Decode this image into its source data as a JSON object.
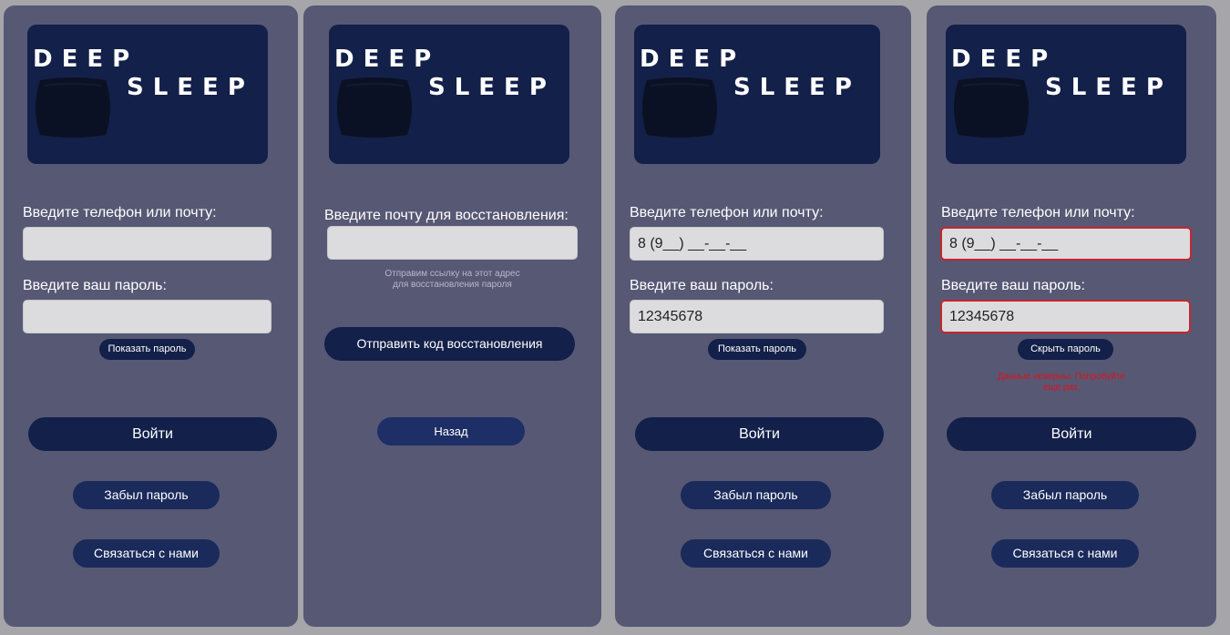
{
  "brand": {
    "word1": "DEEP",
    "word2": "SLEEP"
  },
  "colors": {
    "panel": "#575874",
    "logo_bg": "#132049",
    "button": "#132049",
    "field_bg": "#dcdcde",
    "error": "#e0101a",
    "background": "#a6a6aa"
  },
  "screen1": {
    "login_label": "Введите телефон или почту:",
    "login_value": "",
    "password_label": "Введите ваш пароль:",
    "password_value": "",
    "toggle_label": "Показать пароль",
    "submit_label": "Войти",
    "forgot_label": "Забыл пароль",
    "contact_label": "Связаться с нами"
  },
  "screen2": {
    "email_label": "Введите почту для восстановления:",
    "email_value": "",
    "hint_line1": "Отправим ссылку на этот адрес",
    "hint_line2": "для восстановления пароля",
    "send_label": "Отправить код восстановления",
    "back_label": "Назад"
  },
  "screen3": {
    "login_label": "Введите телефон или почту:",
    "login_value": "8 (9__) __-__-__",
    "password_label": "Введите ваш пароль:",
    "password_value": "12345678",
    "toggle_label": "Показать пароль",
    "submit_label": "Войти",
    "forgot_label": "Забыл пароль",
    "contact_label": "Связаться с нами"
  },
  "screen4": {
    "login_label": "Введите телефон или почту:",
    "login_value": "8 (9__) __-__-__",
    "password_label": "Введите ваш пароль:",
    "password_value": "12345678",
    "toggle_label": "Скрыть пароль",
    "error_line1": "Данные неверны. Попробуйте",
    "error_line2": "еще раз.",
    "submit_label": "Войти",
    "forgot_label": "Забыл пароль",
    "contact_label": "Связаться с нами"
  }
}
